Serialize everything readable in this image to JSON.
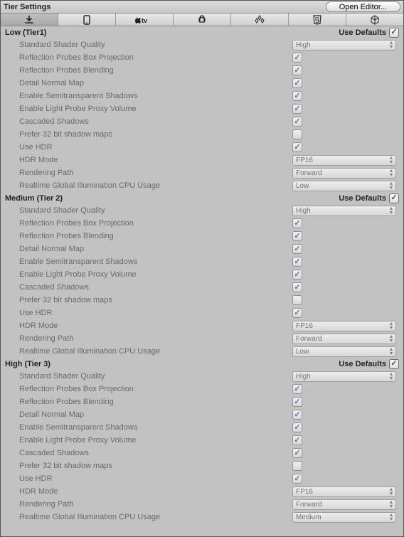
{
  "header": {
    "title": "Tier Settings",
    "open_editor": "Open Editor..."
  },
  "use_defaults_label": "Use Defaults",
  "tiers": [
    {
      "title": "Low (Tier1)",
      "use_defaults": true,
      "rows": [
        {
          "label": "Standard Shader Quality",
          "type": "select",
          "value": "High"
        },
        {
          "label": "Reflection Probes Box Projection",
          "type": "check",
          "value": true
        },
        {
          "label": "Reflection Probes Blending",
          "type": "check",
          "value": true
        },
        {
          "label": "Detail Normal Map",
          "type": "check",
          "value": true
        },
        {
          "label": "Enable Semitransparent Shadows",
          "type": "check",
          "value": true
        },
        {
          "label": "Enable Light Probe Proxy Volume",
          "type": "check",
          "value": true
        },
        {
          "label": "Cascaded Shadows",
          "type": "check",
          "value": true
        },
        {
          "label": "Prefer 32 bit shadow maps",
          "type": "check",
          "value": false
        },
        {
          "label": "Use HDR",
          "type": "check",
          "value": true
        },
        {
          "label": "HDR Mode",
          "type": "select",
          "value": "FP16"
        },
        {
          "label": "Rendering Path",
          "type": "select",
          "value": "Forward"
        },
        {
          "label": "Realtime Global Illumination CPU Usage",
          "type": "select",
          "value": "Low"
        }
      ]
    },
    {
      "title": "Medium (Tier 2)",
      "use_defaults": true,
      "rows": [
        {
          "label": "Standard Shader Quality",
          "type": "select",
          "value": "High"
        },
        {
          "label": "Reflection Probes Box Projection",
          "type": "check",
          "value": true
        },
        {
          "label": "Reflection Probes Blending",
          "type": "check",
          "value": true
        },
        {
          "label": "Detail Normal Map",
          "type": "check",
          "value": true
        },
        {
          "label": "Enable Semitransparent Shadows",
          "type": "check",
          "value": true
        },
        {
          "label": "Enable Light Probe Proxy Volume",
          "type": "check",
          "value": true
        },
        {
          "label": "Cascaded Shadows",
          "type": "check",
          "value": true
        },
        {
          "label": "Prefer 32 bit shadow maps",
          "type": "check",
          "value": false
        },
        {
          "label": "Use HDR",
          "type": "check",
          "value": true
        },
        {
          "label": "HDR Mode",
          "type": "select",
          "value": "FP16"
        },
        {
          "label": "Rendering Path",
          "type": "select",
          "value": "Forward"
        },
        {
          "label": "Realtime Global Illumination CPU Usage",
          "type": "select",
          "value": "Low"
        }
      ]
    },
    {
      "title": "High (Tier 3)",
      "use_defaults": true,
      "rows": [
        {
          "label": "Standard Shader Quality",
          "type": "select",
          "value": "High"
        },
        {
          "label": "Reflection Probes Box Projection",
          "type": "check",
          "value": true
        },
        {
          "label": "Reflection Probes Blending",
          "type": "check",
          "value": true
        },
        {
          "label": "Detail Normal Map",
          "type": "check",
          "value": true
        },
        {
          "label": "Enable Semitransparent Shadows",
          "type": "check",
          "value": true
        },
        {
          "label": "Enable Light Probe Proxy Volume",
          "type": "check",
          "value": true
        },
        {
          "label": "Cascaded Shadows",
          "type": "check",
          "value": true
        },
        {
          "label": "Prefer 32 bit shadow maps",
          "type": "check",
          "value": false
        },
        {
          "label": "Use HDR",
          "type": "check",
          "value": true
        },
        {
          "label": "HDR Mode",
          "type": "select",
          "value": "FP16"
        },
        {
          "label": "Rendering Path",
          "type": "select",
          "value": "Forward"
        },
        {
          "label": "Realtime Global Illumination CPU Usage",
          "type": "select",
          "value": "Medium"
        }
      ]
    }
  ],
  "tabs": [
    {
      "name": "download-icon",
      "active": true
    },
    {
      "name": "phone-icon",
      "active": false
    },
    {
      "name": "appletv-icon",
      "active": false
    },
    {
      "name": "android-icon",
      "active": false
    },
    {
      "name": "webgl-icon",
      "active": false
    },
    {
      "name": "html5-icon",
      "active": false
    },
    {
      "name": "cube-icon",
      "active": false
    }
  ]
}
